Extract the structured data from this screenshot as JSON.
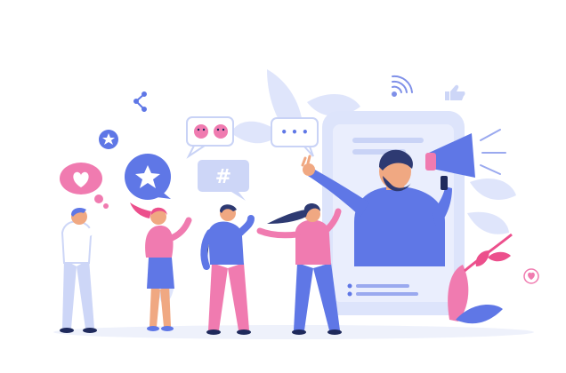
{
  "illustration": {
    "hashtag_symbol": "#",
    "ellipsis_symbol": "• • •"
  },
  "colors": {
    "background": "#ffffff",
    "floor": "#eef1fb",
    "phone_frame": "#dde4fb",
    "phone_screen": "#eaeefd",
    "blue": "#5f77e6",
    "light_blue": "#cdd6f7",
    "pink": "#f07bb0",
    "hot_pink": "#ec4f8c",
    "skin": "#f0a882",
    "dark_hair": "#2e3a72",
    "navy": "#1f2a5c"
  }
}
